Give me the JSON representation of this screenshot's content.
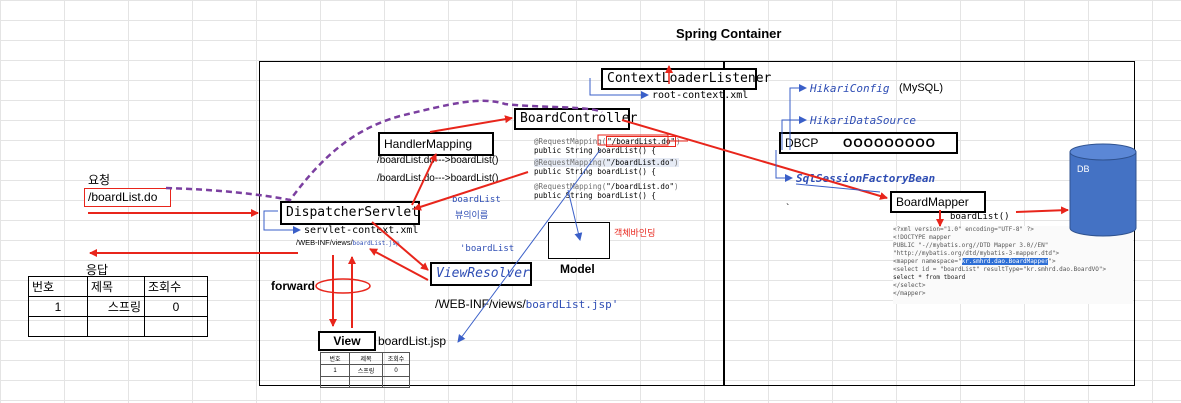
{
  "title": "Spring Container",
  "request": {
    "label": "요청",
    "url": "/boardList.do"
  },
  "response": {
    "label": "응답",
    "headers": [
      "번호",
      "제목",
      "조회수"
    ],
    "rows": [
      [
        "1",
        "스프링",
        "0"
      ],
      [
        "",
        "",
        ""
      ]
    ]
  },
  "dispatcher": {
    "name": "DispatcherServlet",
    "config": "servlet-context.xml",
    "path_prefix": "/WEB-INF/views/",
    "path_file": "boardList.jsp"
  },
  "handler_mapping": {
    "name": "HandlerMapping",
    "mappings": [
      "/boardList.do--->boardList()",
      "/boardList.do--->boardList()"
    ]
  },
  "controller": {
    "name": "BoardController",
    "code": [
      {
        "annotation_prefix": "@RequestMapping(",
        "annotation_value": "\"/boardList.do\"",
        "annotation_suffix": ")",
        "method": "public String boardList() {"
      },
      {
        "annotation_prefix": "@RequestMapping(",
        "annotation_value": "\"/boardList.do\"",
        "annotation_suffix": ")",
        "method": "public String boardList() {"
      },
      {
        "annotation_prefix": "@RequestMapping(",
        "annotation_value": "\"/boardList.do\"",
        "annotation_suffix": ")",
        "method": "public String boardList() {"
      }
    ]
  },
  "view_name": {
    "value": "boardList",
    "label": "뷰의이름"
  },
  "view_name_quoted": "'boardList",
  "model": {
    "label": "Model",
    "binding": "객체바인딩"
  },
  "view_resolver": {
    "name": "ViewResolver",
    "path_prefix": "/WEB-INF/views/",
    "path_file": "boardList.jsp'"
  },
  "forward": "forward",
  "view": {
    "label": "View",
    "file": "boardList.jsp",
    "headers": [
      "번호",
      "제목",
      "조회수"
    ],
    "rows": [
      [
        "1",
        "스프링",
        "0"
      ],
      [
        "",
        "",
        ""
      ]
    ]
  },
  "context_loader": {
    "name": "ContextLoaderListener",
    "config": "root-context.xml"
  },
  "hikari_config": {
    "name": "HikariConfig",
    "note": "(MySQL)"
  },
  "hikari_datasource": "HikariDataSource",
  "dbcp": {
    "label": "DBCP",
    "value": "OOOOOOOOO"
  },
  "sql_session_factory": "SqlSessionFactoryBean",
  "board_mapper": {
    "name": "BoardMapper",
    "method": "boardList()"
  },
  "backtick": "`",
  "mapper_xml": {
    "line1": "<?xml version=\"1.0\" encoding=\"UTF-8\" ?>",
    "line2": "<!DOCTYPE mapper",
    "line3": "  PUBLIC \"-//mybatis.org//DTD Mapper 3.0//EN\"",
    "line4": "  \"http://mybatis.org/dtd/mybatis-3-mapper.dtd\">",
    "line5_prefix": "<mapper namespace=\"",
    "line5_namespace": "kr.smhrd.dao.BoardMapper",
    "line5_suffix": "\">",
    "line6": "    <select id = \"boardList\" resultType=\"kr.smhrd.dao.BoardVO\">",
    "line7": "        select * from tboard",
    "line8": "    </select>",
    "line9": "</mapper>"
  },
  "db": {
    "label": "DB"
  },
  "colors": {
    "arrow_red": "#e8251b",
    "dashed_purple": "#7b3fa0",
    "blue": "#2e4db4",
    "db_fill": "#4472c4"
  }
}
